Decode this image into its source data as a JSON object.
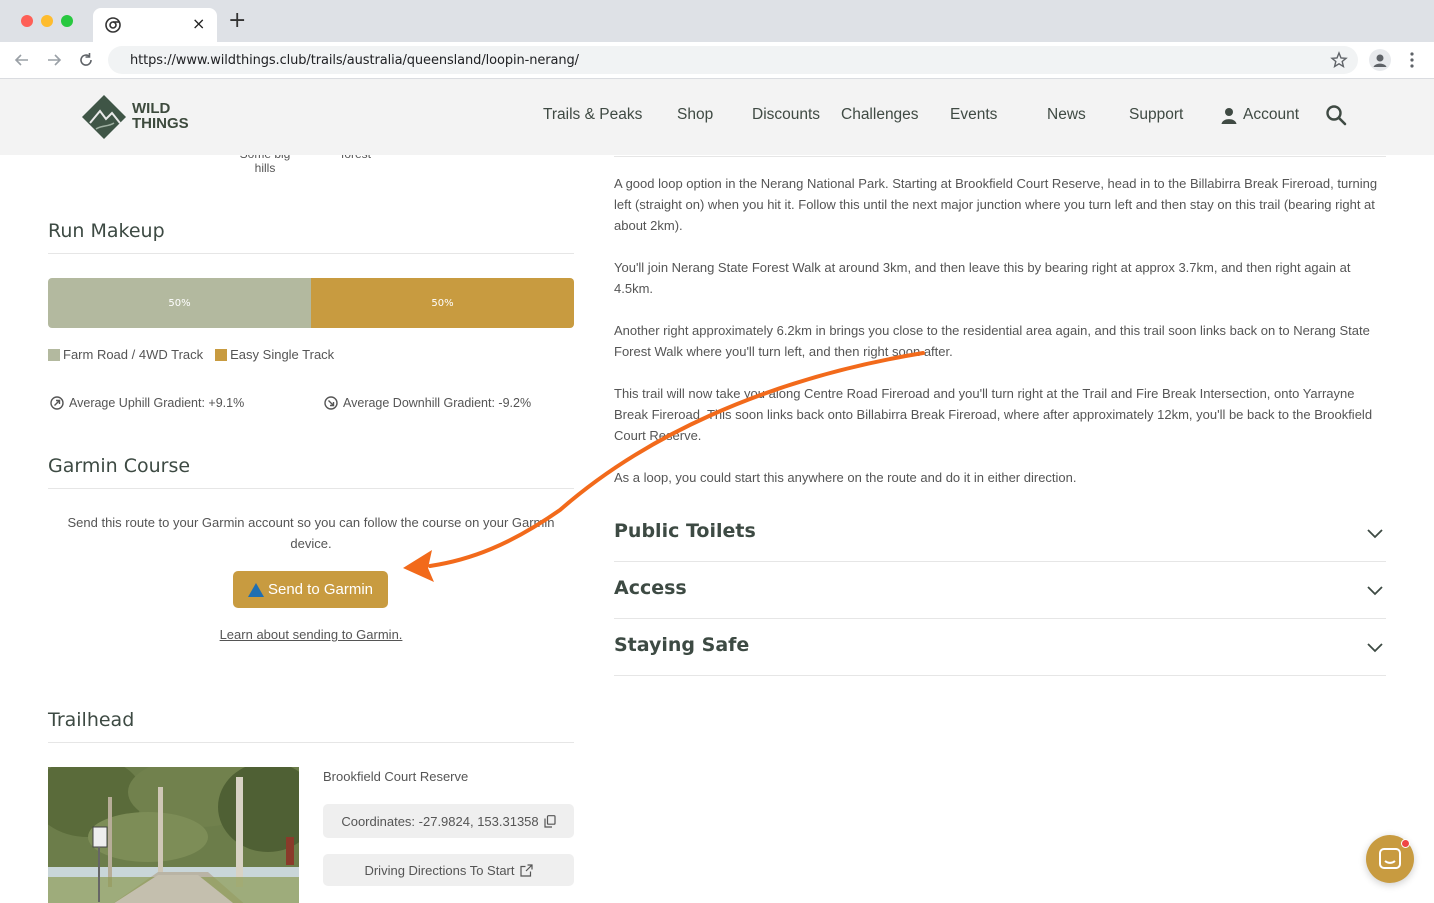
{
  "browser": {
    "url": "https://www.wildthings.club/trails/australia/queensland/loopin-nerang/",
    "tab_close": "×",
    "new_tab": "+"
  },
  "header": {
    "logo_line1": "WILD",
    "logo_line2": "THINGS",
    "nav": [
      {
        "label": "Trails & Peaks"
      },
      {
        "label": "Shop"
      },
      {
        "label": "Discounts"
      },
      {
        "label": "Challenges"
      },
      {
        "label": "Events"
      },
      {
        "label": "News"
      },
      {
        "label": "Support"
      },
      {
        "label": "Account"
      }
    ]
  },
  "left": {
    "cut_text_1": "Some big",
    "cut_text_1b": "hills",
    "cut_text_2": "forest",
    "run_makeup": {
      "title": "Run Makeup",
      "segments": [
        {
          "label": "50%",
          "value": 50,
          "color": "#b3b99f"
        },
        {
          "label": "50%",
          "value": 50,
          "color": "#c89b40"
        }
      ],
      "legend": [
        {
          "label": "Farm Road / 4WD Track",
          "color": "#b3b99f"
        },
        {
          "label": "Easy Single Track",
          "color": "#c89b40"
        }
      ],
      "uphill": "Average Uphill Gradient: +9.1%",
      "downhill": "Average Downhill Gradient: -9.2%"
    },
    "garmin": {
      "title": "Garmin Course",
      "description": "Send this route to your Garmin account so you can follow the course on your Garmin device.",
      "button": "Send to Garmin",
      "link": "Learn about sending to Garmin."
    },
    "trailhead": {
      "title": "Trailhead",
      "name": "Brookfield Court Reserve",
      "coordinates": "Coordinates: -27.9824, 153.31358",
      "directions": "Driving Directions To Start"
    }
  },
  "right": {
    "paragraphs": [
      "A good loop option in the Nerang National Park. Starting at Brookfield Court Reserve, head in to the Billabirra Break Fireroad, turning left (straight on) when you hit it. Follow this until the next major junction where you turn left and then stay on this trail (bearing right at about 2km).",
      "You'll join Nerang State Forest Walk at around 3km, and then leave this by bearing right at approx 3.7km, and then right again at 4.5km.",
      "Another right approximately 6.2km in brings you close to the residential area again, and this trail soon links back on to Nerang State Forest Walk where you'll turn left, and then right soon after.",
      "This trail will now take you along Centre Road Fireroad and you'll turn right at the Trail and Fire Break Intersection, onto Yarrayne Break Fireroad. This soon links back onto Billabirra Break Fireroad, where after approximately 12km, you'll be back to the Brookfield Court Reserve.",
      "As a loop, you could start this anywhere on the route and do it in either direction."
    ],
    "accordions": [
      {
        "title": "Public Toilets"
      },
      {
        "title": "Access"
      },
      {
        "title": "Staying Safe"
      }
    ]
  },
  "colors": {
    "accent": "#c89b40",
    "farm_road": "#b3b99f",
    "annotation_arrow": "#f26a1b"
  }
}
